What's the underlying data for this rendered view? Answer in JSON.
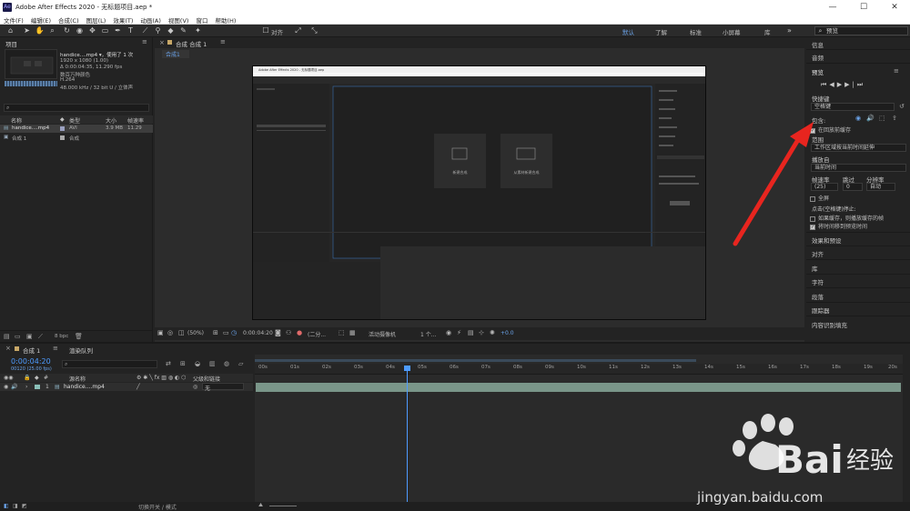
{
  "window": {
    "title": "Adobe After Effects 2020 - 无标题项目.aep *",
    "logo_text": "Ae",
    "minimize": "—",
    "maximize": "☐",
    "close": "✕"
  },
  "menu": [
    "文件(F)",
    "编辑(E)",
    "合成(C)",
    "图层(L)",
    "效果(T)",
    "动画(A)",
    "视图(V)",
    "窗口",
    "帮助(H)"
  ],
  "toolbar": {
    "snap_label": "对齐",
    "workspaces": [
      "默认",
      "了解",
      "标准",
      "小屏幕",
      "库"
    ],
    "search_value": "预览"
  },
  "project": {
    "title": "项目",
    "file_name": "handice....mp4 ▾",
    "used": "，使用了 1 次",
    "resolution": "1920 x 1080 (1.00)",
    "duration": "Δ 0:00:04:35, 11.290 fps",
    "colors": "数百万种颜色",
    "codec": "H.264",
    "audio": "48.000 kHz / 32 bit U / 立体声",
    "columns": [
      "名称",
      "类型",
      "大小",
      "帧速率"
    ],
    "rows": [
      {
        "name": "handice....mp4",
        "type": "AVI",
        "size": "3.9 MB",
        "fps": "11.29"
      },
      {
        "name": "合成 1",
        "type": "合成",
        "size": "",
        "fps": ""
      }
    ],
    "bpc": "8 bpc"
  },
  "viewer": {
    "tab": "合成 合成 1",
    "subtab": "合成1",
    "zoom": "(50%)",
    "time": "0:00:04:20",
    "resolution": "(二分...",
    "camera": "活动摄像机",
    "views": "1 个...",
    "exposure": "+0.0",
    "inner_window_title": "Adobe After Effects 2020 - 无标题项目.aep",
    "inner_new_comp": "新建合成",
    "inner_from_footage": "从素材新建合成"
  },
  "right_panel": {
    "info": "信息",
    "audio": "音频",
    "preview": "预览",
    "shortcut_label": "快捷键",
    "shortcut_value": "空格键",
    "include_label": "包含:",
    "cache_before_play": "在回放前缓存",
    "range_label": "范围",
    "range_value": "工作区域按当前时间延伸",
    "play_from_label": "播放自",
    "play_from_value": "当前时间",
    "framerate_label": "帧速率",
    "skip_label": "跳过",
    "resolution_label": "分辨率",
    "framerate_value": "(25)",
    "skip_value": "0",
    "resolution_value": "自动",
    "fullscreen": "全屏",
    "on_stop_label": "点击(空格键)停止:",
    "if_caching": "如果缓存，则播放缓存的帧",
    "move_time": "将时间移到预览时间",
    "effects": "效果和预设",
    "align": "对齐",
    "library": "库",
    "character": "字符",
    "paragraph": "段落",
    "tracker": "跟踪器",
    "content_aware": "内容识别填充"
  },
  "timeline": {
    "tab_comp": "合成 1",
    "tab_render": "渲染队列",
    "current_time": "0:00:04:20",
    "fps_text": "00120 (25.00 fps)",
    "col_name": "源名称",
    "col_parent": "父级和链接",
    "layer_index": "1",
    "layer_name": "handice....mp4",
    "layer_parent": "无",
    "ticks": [
      "00s",
      "01s",
      "02s",
      "03s",
      "04s",
      "05s",
      "06s",
      "07s",
      "08s",
      "09s",
      "10s",
      "11s",
      "12s",
      "13s",
      "14s",
      "15s",
      "16s",
      "17s",
      "18s",
      "19s",
      "20s"
    ],
    "toggle_label": "切换开关 / 模式"
  },
  "watermark": {
    "brand": "Bai",
    "brand2": "经验",
    "url": "jingyan.baidu.com"
  },
  "colors": {
    "accent_blue": "#4d9bff",
    "layer_bar": "#7a9689",
    "arrow_red": "#e8251f"
  }
}
